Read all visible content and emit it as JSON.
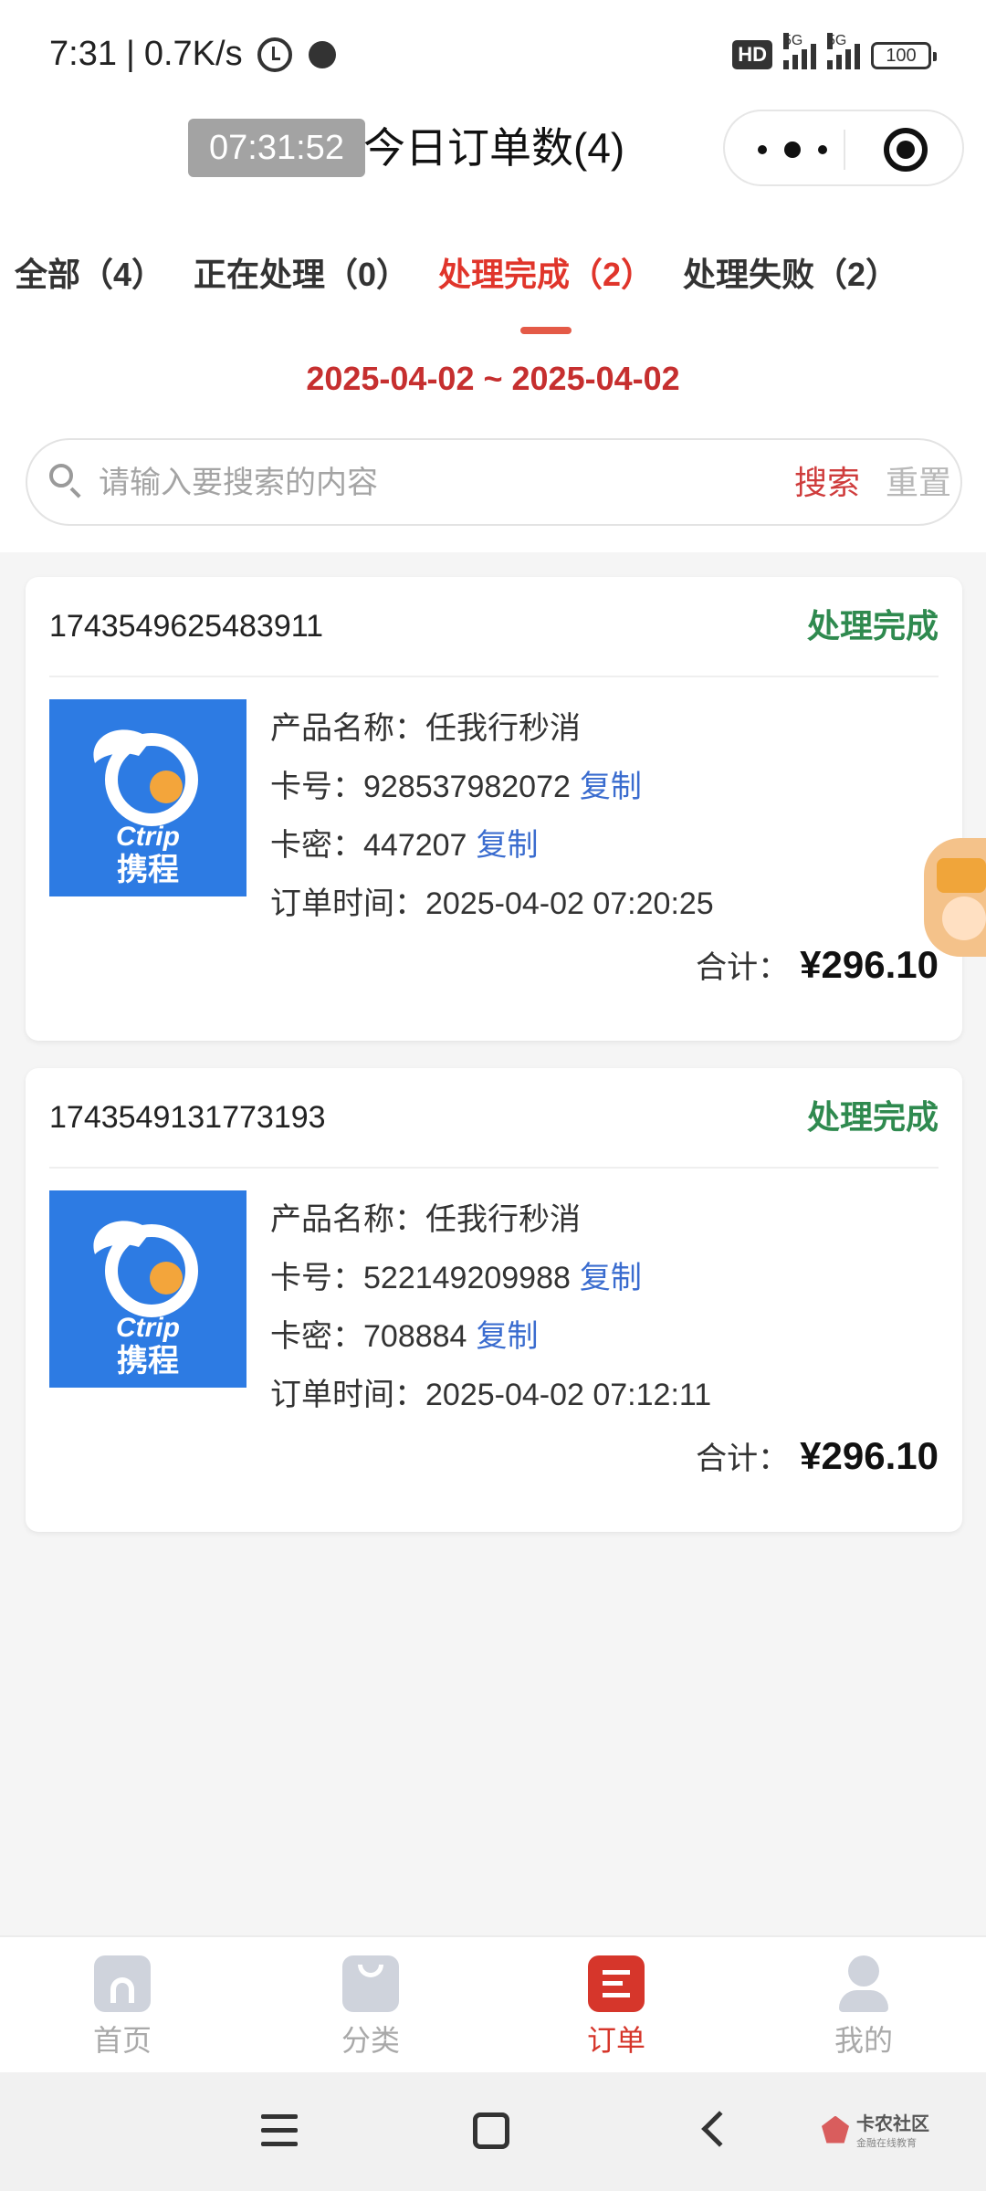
{
  "status_bar": {
    "time": "7:31",
    "separator": "|",
    "network_speed": "0.7K/s",
    "hd_badge": "HD",
    "signal1_label": "5G",
    "signal2_label": "5G",
    "battery": "100"
  },
  "header": {
    "time_badge": "07:31:52",
    "title": "今日订单数(4)"
  },
  "tabs": [
    {
      "label": "全部（4）"
    },
    {
      "label": "正在处理（0）"
    },
    {
      "label": "处理完成（2）",
      "active": true
    },
    {
      "label": "处理失败（2）"
    }
  ],
  "date_range": "2025-04-02 ~ 2025-04-02",
  "search": {
    "placeholder": "请输入要搜索的内容",
    "value": "",
    "search_label": "搜索",
    "reset_label": "重置"
  },
  "orders": [
    {
      "order_no": "1743549625483911",
      "status": "处理完成",
      "brand_en": "Ctrip",
      "brand_cn": "携程",
      "product_label": "产品名称：",
      "product_name": "任我行秒消",
      "card_no_label": "卡号：",
      "card_no": "928537982072",
      "card_pwd_label": "卡密：",
      "card_pwd": "447207",
      "copy_label": "复制",
      "time_label": "订单时间：",
      "time": "2025-04-02 07:20:25",
      "total_label": "合计：",
      "total": "¥296.10"
    },
    {
      "order_no": "1743549131773193",
      "status": "处理完成",
      "brand_en": "Ctrip",
      "brand_cn": "携程",
      "product_label": "产品名称：",
      "product_name": "任我行秒消",
      "card_no_label": "卡号：",
      "card_no": "522149209988",
      "card_pwd_label": "卡密：",
      "card_pwd": "708884",
      "copy_label": "复制",
      "time_label": "订单时间：",
      "time": "2025-04-02 07:12:11",
      "total_label": "合计：",
      "total": "¥296.10"
    }
  ],
  "bottom_nav": [
    {
      "label": "首页",
      "icon": "home-icon"
    },
    {
      "label": "分类",
      "icon": "category-icon"
    },
    {
      "label": "订单",
      "icon": "order-icon",
      "active": true
    },
    {
      "label": "我的",
      "icon": "profile-icon"
    }
  ],
  "watermark": {
    "main": "卡农社区",
    "sub": "金融在线教育"
  },
  "colors": {
    "accent": "#e0352b",
    "status_done": "#2f8a4f",
    "link": "#3a6ccf",
    "ctrip_blue": "#2d7be3"
  }
}
